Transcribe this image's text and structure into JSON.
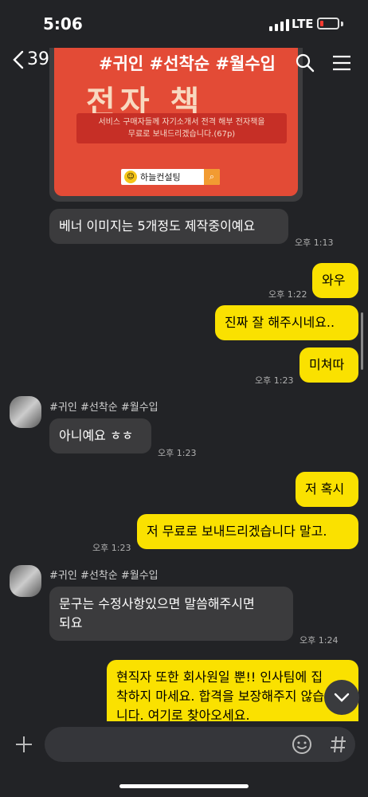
{
  "status": {
    "time": "5:06",
    "network": "LTE"
  },
  "header": {
    "back_count": "39",
    "title": "#귀인 #선착순 #월수입"
  },
  "banner": {
    "headline": "전자 책",
    "text_line1": "서비스 구매자들께 자기소개서 전격 해부 전자책을",
    "text_line2": "무료로 보내드리겠습니다.(67p)",
    "brand": "하늘컨설팅"
  },
  "messages": [
    {
      "dir": "in",
      "text": "베너 이미지는 5개정도 제작중이예요",
      "time": "오후 1:13"
    },
    {
      "dir": "out",
      "text": "와우",
      "time": "오후 1:22"
    },
    {
      "dir": "out",
      "text": "진짜 잘 해주시네요..",
      "time": ""
    },
    {
      "dir": "out",
      "text": "미쳐따",
      "time": "오후 1:23"
    },
    {
      "dir": "in",
      "sender": "#귀인 #선착순 #월수입",
      "text": "아니예요 ㅎㅎ",
      "time": "오후 1:23"
    },
    {
      "dir": "out",
      "text": "저 혹시",
      "time": ""
    },
    {
      "dir": "out",
      "text": "저 무료로 보내드리겠습니다 말고.",
      "time": "오후 1:23"
    },
    {
      "dir": "in",
      "sender": "#귀인 #선착순 #월수입",
      "text_line1": "문구는 수정사항있으면 말씀해주시면",
      "text_line2": "되요",
      "time": "오후 1:24"
    },
    {
      "dir": "out",
      "text_line1": "현직자 또한 회사원일 뿐!! 인사팀에 집",
      "text_line2": "착하지 마세요. 합격을 보장해주지 않습",
      "text_line3": "니다. 여기로 찾아오세요.",
      "time": ""
    }
  ],
  "battery_level": 0.2,
  "icons": [
    "search-icon",
    "menu-icon",
    "chevron-left-icon",
    "chevron-down-icon",
    "plus-icon",
    "emoji-icon",
    "hash-icon"
  ]
}
